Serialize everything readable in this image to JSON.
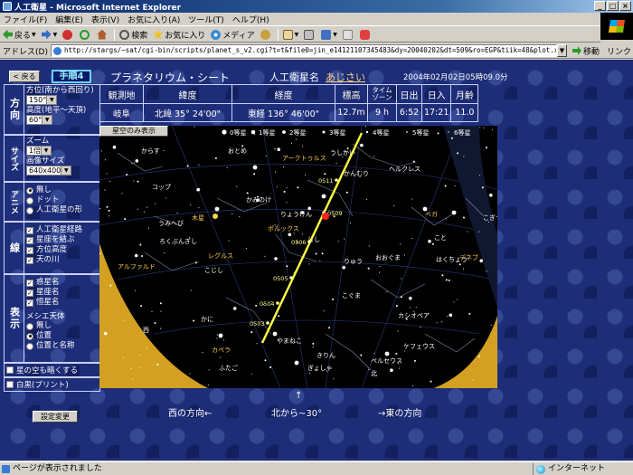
{
  "window": {
    "title": "人工衛星 - Microsoft Internet Explorer"
  },
  "menu": [
    "ファイル(F)",
    "編集(E)",
    "表示(V)",
    "お気に入り(A)",
    "ツール(T)",
    "ヘルプ(H)"
  ],
  "toolbar": {
    "back": "戻る",
    "search": "検索",
    "favorites": "お気に入り",
    "media": "メディア"
  },
  "address": {
    "label": "アドレス(D)",
    "url": "http://stargs/~sat/cgi-bin/scripts/planet_s_v2.cgi?t=t&file0=jin_e14121107345483&dy=20040202&dt=509&ro=EGP&tiik=48&plot.x=357&plot.y=242",
    "go": "移動",
    "links": "リンク"
  },
  "header": {
    "back_btn": "< 戻る",
    "step": "手順4",
    "title": "プラネタリウム・シート",
    "sat_label": "人工衛星名",
    "sat_name": "あじさい",
    "datetime": "2004年02月02日05時09.0分"
  },
  "info": {
    "headers": [
      "観測地",
      "緯度",
      "経度",
      "標高",
      "タイム\nゾーン",
      "日出",
      "日入",
      "月齢"
    ],
    "values": [
      "岐阜",
      "北緯 35° 24'00\"",
      "東経 136° 46'00\"",
      "12.7m",
      "9 h",
      "6:52",
      "17:21",
      "11.0"
    ]
  },
  "panel": {
    "direction": {
      "head": "方向",
      "azimuth_label": "方位(南から西回り)",
      "azimuth_value": "150°",
      "altitude_label": "高度(地平～天頂)",
      "altitude_value": "60°"
    },
    "size": {
      "head": "サイズ",
      "zoom_label": "ズーム",
      "zoom_value": "1倍",
      "image_label": "画像サイズ",
      "image_value": "640x400"
    },
    "anime": {
      "head": "アニメ",
      "options": [
        "無し",
        "ドット",
        "人工衛星の形"
      ]
    },
    "lines": {
      "head": "線",
      "options": [
        "人工衛星経路",
        "星座を結ぶ",
        "方位高度",
        "天の川"
      ]
    },
    "names": {
      "options": [
        "惑星名",
        "星座名",
        "恒星名"
      ]
    },
    "display": {
      "head": "表示",
      "messier_label": "メシエ天体",
      "options": [
        "無し",
        "位置",
        "位置と名称"
      ]
    },
    "dark_sky": "星の空も暗くする",
    "print": "白黒(プリント)",
    "apply": "設定変更"
  },
  "sky": {
    "tab": "星空のみ表示",
    "legend": [
      "0等星",
      "1等星",
      "2等星",
      "3等星",
      "4等星",
      "5等星",
      "6等星"
    ],
    "labels": [
      {
        "t": "からす",
        "c": "#fff"
      },
      {
        "t": "おとめ",
        "c": "#fff"
      },
      {
        "t": "アークトゥルス",
        "c": "#ffd24d"
      },
      {
        "t": "うしかい",
        "c": "#fff"
      },
      {
        "t": "かんむり",
        "c": "#fff"
      },
      {
        "t": "ヘルクレス",
        "c": "#fff"
      },
      {
        "t": "コップ",
        "c": "#fff"
      },
      {
        "t": "かみのけ",
        "c": "#fff"
      },
      {
        "t": "りょうけん",
        "c": "#fff"
      },
      {
        "t": "うみへび",
        "c": "#fff"
      },
      {
        "t": "木星",
        "c": "#ffd24d"
      },
      {
        "t": "しし",
        "c": "#fff"
      },
      {
        "t": "ろくぶんぎし",
        "c": "#fff"
      },
      {
        "t": "レグルス",
        "c": "#ffd24d"
      },
      {
        "t": "こじし",
        "c": "#fff"
      },
      {
        "t": "おおぐま",
        "c": "#fff"
      },
      {
        "t": "アルファルド",
        "c": "#ffd24d"
      },
      {
        "t": "かに",
        "c": "#fff"
      },
      {
        "t": "やまねこ",
        "c": "#fff"
      },
      {
        "t": "きりん",
        "c": "#fff"
      },
      {
        "t": "ふたご",
        "c": "#fff"
      },
      {
        "t": "カペラ",
        "c": "#ffd24d"
      },
      {
        "t": "ぎょしゃ",
        "c": "#fff"
      },
      {
        "t": "ペルセウス",
        "c": "#fff"
      },
      {
        "t": "カシオペア",
        "c": "#fff"
      },
      {
        "t": "ケフェウス",
        "c": "#fff"
      },
      {
        "t": "こぐま",
        "c": "#fff"
      },
      {
        "t": "りゅう",
        "c": "#fff"
      },
      {
        "t": "ベガ",
        "c": "#ffd24d"
      },
      {
        "t": "こと",
        "c": "#fff"
      },
      {
        "t": "はくちょう",
        "c": "#fff"
      },
      {
        "t": "デネブ",
        "c": "#ffd24d"
      },
      {
        "t": "ポルックス",
        "c": "#ffd24d"
      },
      {
        "t": "西",
        "c": "#fff"
      },
      {
        "t": "北",
        "c": "#fff"
      },
      {
        "t": "こぎつね",
        "c": "#fff"
      }
    ],
    "track": [
      "0511",
      "0509",
      "0506",
      "0505",
      "0504",
      "0503"
    ]
  },
  "directions": {
    "west": "西の方向←",
    "north": "北から~30°",
    "up_arrow": "↑",
    "east": "→東の方向"
  },
  "status": {
    "main": "ページが表示されました",
    "zone": "インターネット"
  },
  "colors": {
    "sky": "#000000",
    "horizon": "#d4a021",
    "track": "#ffff40",
    "page_bg": "#1d2d78"
  }
}
